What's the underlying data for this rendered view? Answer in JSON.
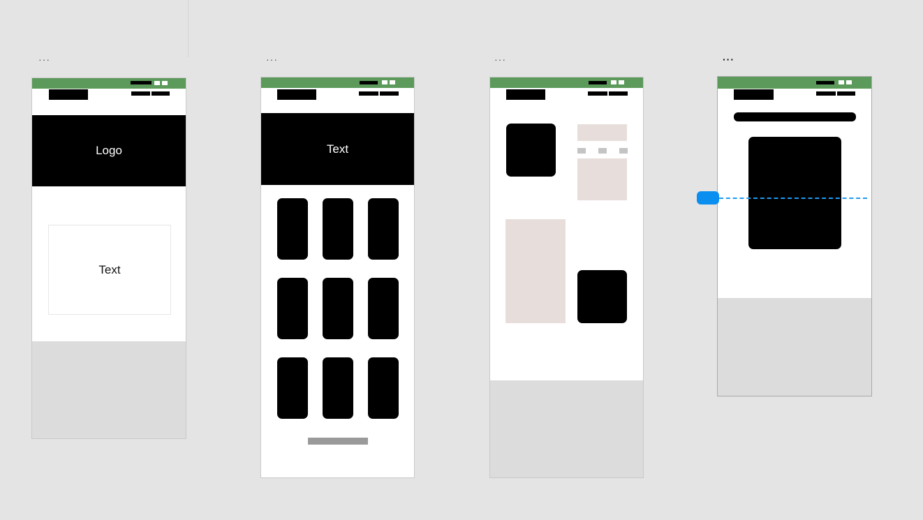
{
  "frames": [
    {
      "menu": "···",
      "hero_text": "Logo",
      "box_text": "Text"
    },
    {
      "menu": "···",
      "hero_text": "Text"
    },
    {
      "menu": "···"
    },
    {
      "menu": "···"
    }
  ],
  "colors": {
    "canvas": "#e4e4e4",
    "statusbar": "#5b9a5a",
    "guide": "#1e9bf2",
    "placeholder": "#e7dedb",
    "footer": "#dcdcdc"
  },
  "icons": [
    "more-icon",
    "status-bar-icon",
    "guide-handle-icon"
  ]
}
